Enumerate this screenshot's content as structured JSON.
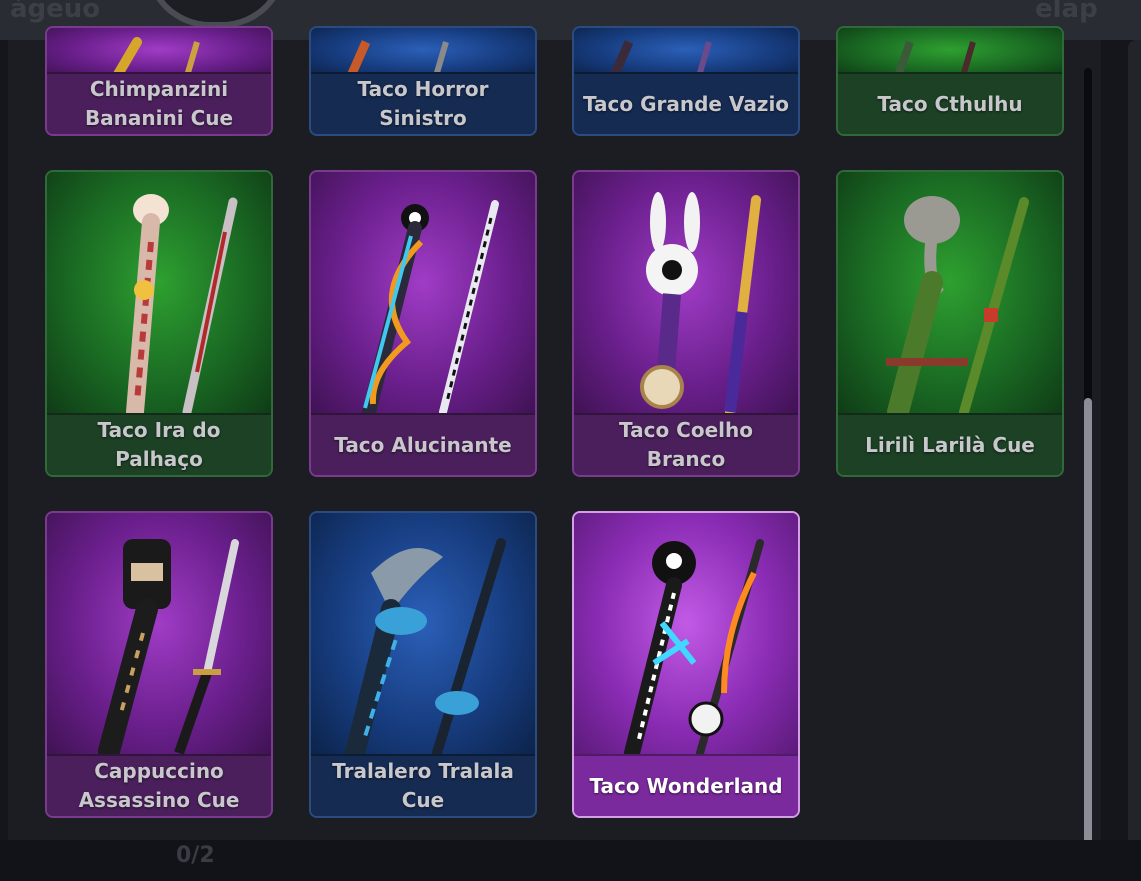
{
  "header": {
    "ghost_left": "ágeuo",
    "ghost_right": "elap"
  },
  "footer": {
    "pager": "0/2"
  },
  "cards": [
    {
      "label": "Chimpanzini Bananini Cue",
      "theme": "purple"
    },
    {
      "label": "Taco Horror Sinistro",
      "theme": "blue"
    },
    {
      "label": "Taco Grande Vazio",
      "theme": "blue"
    },
    {
      "label": "Taco Cthulhu",
      "theme": "green"
    },
    {
      "label": "Taco Ira do Palhaço",
      "theme": "green"
    },
    {
      "label": "Taco Alucinante",
      "theme": "purple"
    },
    {
      "label": "Taco Coelho Branco",
      "theme": "purple"
    },
    {
      "label": "Lirilì Larilà Cue",
      "theme": "green"
    },
    {
      "label": "Cappuccino Assassino Cue",
      "theme": "purple"
    },
    {
      "label": "Tralalero Tralala Cue",
      "theme": "blue"
    },
    {
      "label": "Taco Wonderland",
      "theme": "purple",
      "selected": true
    }
  ]
}
